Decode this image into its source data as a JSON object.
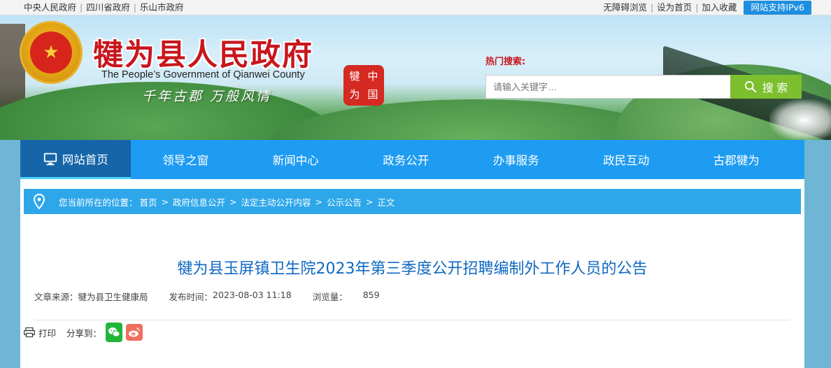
{
  "topbar": {
    "links": [
      "中央人民政府",
      "四川省政府",
      "乐山市政府"
    ],
    "right_links": [
      "无障碍浏览",
      "设为首页",
      "加入收藏"
    ],
    "ipv6": "网站支持IPv6"
  },
  "header": {
    "title": "犍为县人民政府",
    "subtitle": "The People’s Government of Qianwei County",
    "slogan": "千年古郡  万般风情",
    "seal_chars": [
      "犍",
      "中",
      "为",
      "国"
    ],
    "emblem_glyph": "★"
  },
  "search": {
    "hot_label": "热门搜索:",
    "placeholder": "请输入关键字…",
    "button_label": "搜 索"
  },
  "nav": {
    "items": [
      "网站首页",
      "领导之窗",
      "新闻中心",
      "政务公开",
      "办事服务",
      "政民互动",
      "古郡犍为"
    ],
    "active_index": 0
  },
  "breadcrumb": {
    "prefix": "您当前所在的位置：",
    "items": [
      "首页",
      "政府信息公开",
      "法定主动公开内容",
      "公示公告",
      "正文"
    ]
  },
  "article": {
    "title": "犍为县玉屏镇卫生院2023年第三季度公开招聘编制外工作人员的公告",
    "source_label": "文章来源：",
    "source": "犍为县卫生健康局",
    "time_label": "发布时间：",
    "time": "2023-08-03 11:18",
    "views_label": "浏览量：",
    "views": "859"
  },
  "tools": {
    "print_label": "打印",
    "share_label": "分享到："
  },
  "colors": {
    "nav_bg": "#1e9cf2",
    "nav_active": "#1565a8",
    "title_red": "#c8161d",
    "article_title": "#1068c2",
    "search_button": "#7dbf2e",
    "breadcrumb_bg": "#2ea7ea"
  }
}
